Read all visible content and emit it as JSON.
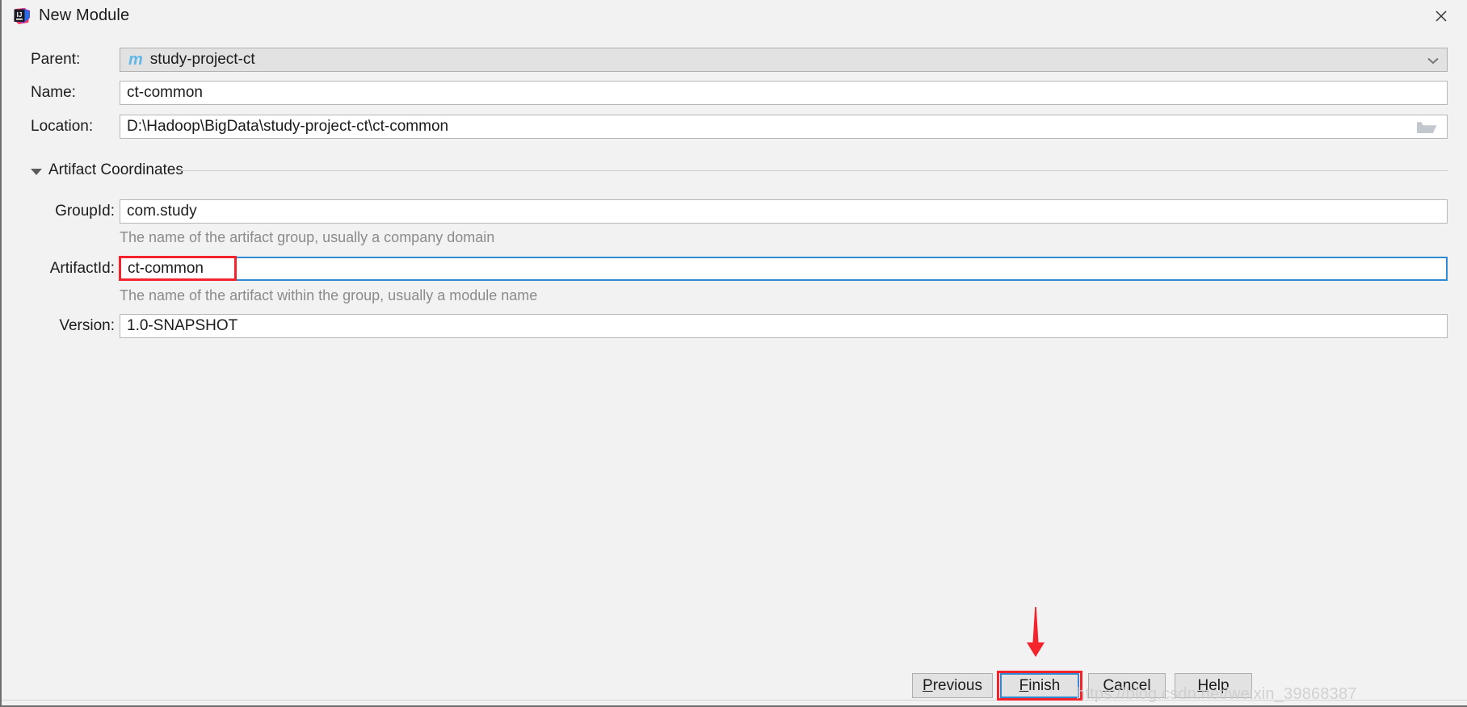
{
  "window": {
    "title": "New Module",
    "app_icon": "intellij-idea-icon",
    "close_icon": "close-icon"
  },
  "form": {
    "parent": {
      "label": "Parent:",
      "value": "study-project-ct",
      "icon": "maven-module-icon",
      "icon_glyph": "m",
      "chevron": "chevron-down-icon"
    },
    "name": {
      "label": "Name:",
      "value": "ct-common"
    },
    "location": {
      "label": "Location:",
      "value": "D:\\Hadoop\\BigData\\study-project-ct\\ct-common",
      "browse_icon": "folder-open-icon"
    }
  },
  "artifact_coordinates": {
    "section_title": "Artifact Coordinates",
    "expanded": true,
    "toggle_icon": "triangle-down-icon",
    "group_id": {
      "label": "GroupId:",
      "value": "com.study",
      "hint": "The name of the artifact group, usually a company domain"
    },
    "artifact_id": {
      "label": "ArtifactId:",
      "value": "ct-common",
      "hint": "The name of the artifact within the group, usually a module name",
      "focused": true
    },
    "version": {
      "label": "Version:",
      "value": "1.0-SNAPSHOT"
    }
  },
  "buttons": {
    "previous": {
      "label": "Previous",
      "mnemonic": "P"
    },
    "finish": {
      "label": "Finish",
      "mnemonic": "F",
      "is_default": true
    },
    "cancel": {
      "label": "Cancel",
      "mnemonic": "C"
    },
    "help": {
      "label": "Help",
      "mnemonic": "H"
    }
  },
  "annotations": {
    "artifactid_box_color": "#f5232c",
    "finish_box_color": "#f5232c",
    "arrow_color": "#f5232c",
    "arrow_icon": "down-arrow-annotation"
  },
  "watermark": {
    "text": "https://blog.csdn.net/weixin_39868387"
  },
  "colors": {
    "background": "#f2f2f2",
    "field_background": "#ffffff",
    "focus_blue": "#2f8ad3",
    "hint_gray": "#8b8b8b",
    "maven_icon_blue": "#61b7e8"
  }
}
